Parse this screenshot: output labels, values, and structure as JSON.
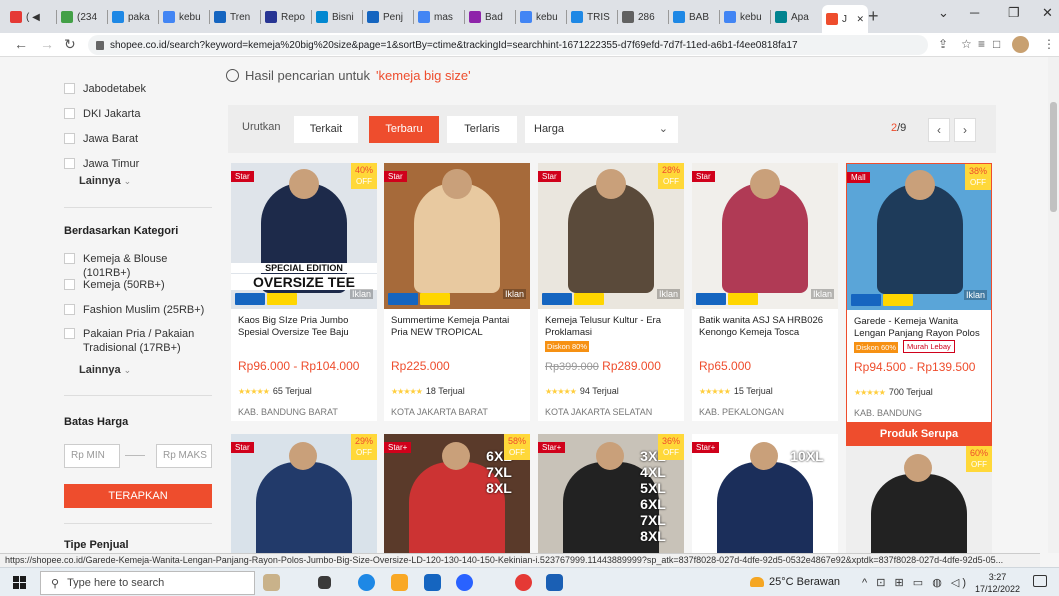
{
  "browser": {
    "tabs": [
      {
        "label": "( ◀",
        "color": "#e53935"
      },
      {
        "label": "(234",
        "color": "#43a047"
      },
      {
        "label": "paka",
        "color": "#1e88e5"
      },
      {
        "label": "kebu",
        "color": "#4285f4"
      },
      {
        "label": "Tren",
        "color": "#1565c0"
      },
      {
        "label": "Repo",
        "color": "#283593"
      },
      {
        "label": "Bisni",
        "color": "#0288d1"
      },
      {
        "label": "Penj",
        "color": "#1565c0"
      },
      {
        "label": "mas",
        "color": "#4285f4"
      },
      {
        "label": "Bad",
        "color": "#8e24aa"
      },
      {
        "label": "kebu",
        "color": "#4285f4"
      },
      {
        "label": "TRIS",
        "color": "#1e88e5"
      },
      {
        "label": "286",
        "color": "#616161"
      },
      {
        "label": "BAB",
        "color": "#1e88e5"
      },
      {
        "label": "kebu",
        "color": "#4285f4"
      },
      {
        "label": "Apa",
        "color": "#00838f"
      },
      {
        "label": "J",
        "color": "#ee4d2d"
      }
    ],
    "new_tab": "+",
    "url": "shopee.co.id/search?keyword=kemeja%20big%20size&page=1&sortBy=ctime&trackingId=searchhint-1671222355-d7f69efd-7d7f-11ed-a6b1-f4ee0818fa17"
  },
  "sidebar": {
    "locations": [
      "Jabodetabek",
      "DKI Jakarta",
      "Jawa Barat",
      "Jawa Timur"
    ],
    "more1": "Lainnya",
    "category_title": "Berdasarkan Kategori",
    "categories": [
      "Kemeja & Blouse (101RB+)",
      "Kemeja (50RB+)",
      "Fashion Muslim (25RB+)",
      "Pakaian Pria / Pakaian Tradisional (17RB+)"
    ],
    "more2": "Lainnya",
    "price_title": "Batas Harga",
    "min_placeholder": "Rp MIN",
    "max_placeholder": "Rp MAKS",
    "apply": "TERAPKAN",
    "type_title": "Tipe Penjual"
  },
  "results": {
    "prefix": "Hasil pencarian untuk",
    "keyword": "'kemeja big size'"
  },
  "sort": {
    "label": "Urutkan",
    "options": [
      "Terkait",
      "Terbaru",
      "Terlaris"
    ],
    "price": "Harga",
    "page_current": "2",
    "page_total": "/9"
  },
  "products": [
    {
      "name": "Kaos Big SIze Pria Jumbo Spesial Oversize Tee Baju Bes...",
      "price": "Rp96.000 - Rp104.000",
      "old_price": "",
      "sold": "65 Terjual",
      "location": "KAB. BANDUNG BARAT",
      "badge": "Star",
      "discount": "40%",
      "tag": "",
      "tag2": "",
      "img_overlay": "SPECIAL EDITION",
      "img_overlay2": "OVERSIZE TEE",
      "bg": "#dfe4ea",
      "fg": "#1d2a4a"
    },
    {
      "name": "Summertime Kemeja Pantai Pria NEW TROPICAL SUMMER...",
      "price": "Rp225.000",
      "old_price": "",
      "sold": "18 Terjual",
      "location": "KOTA JAKARTA BARAT",
      "badge": "Star",
      "discount": "",
      "tag": "",
      "tag2": "",
      "img_overlay": "",
      "img_overlay2": "",
      "bg": "#a66a3a",
      "fg": "#e8c9a0"
    },
    {
      "name": "Kemeja Telusur Kultur - Era Proklamasi",
      "price": "Rp289.000",
      "old_price": "Rp399.000",
      "sold": "94 Terjual",
      "location": "KOTA JAKARTA SELATAN",
      "badge": "Star",
      "discount": "28%",
      "tag": "Diskon 80%",
      "tag2": "",
      "img_overlay": "",
      "img_overlay2": "",
      "bg": "#eae6de",
      "fg": "#5a4a3a"
    },
    {
      "name": "Batik wanita ASJ SA HRB026 Kenongo Kemeja Tosca Pendek",
      "price": "Rp65.000",
      "old_price": "",
      "sold": "15 Terjual",
      "location": "KAB. PEKALONGAN",
      "badge": "Star",
      "discount": "",
      "tag": "",
      "tag2": "",
      "img_overlay": "",
      "img_overlay2": "",
      "bg": "#f1efeb",
      "fg": "#b03a55"
    },
    {
      "name": "Garede - Kemeja Wanita Lengan Panjang Rayon Polos Jumbo...",
      "price": "Rp94.500 - Rp139.500",
      "old_price": "",
      "sold": "700 Terjual",
      "location": "KAB. BANDUNG",
      "badge": "Mall",
      "discount": "38%",
      "tag": "Diskon 60%",
      "tag2": "Murah Lebay",
      "img_overlay": "",
      "img_overlay2": "",
      "bg": "#5aa5d8",
      "fg": "#1e3b5a"
    }
  ],
  "products_row2": [
    {
      "badge": "Star",
      "discount": "29%",
      "bg": "#d9e2ea",
      "fg": "#223a6a",
      "overlay": ""
    },
    {
      "badge": "Star+",
      "discount": "58%",
      "bg": "#5a3a2a",
      "fg": "#c33",
      "overlay": "6XL 7XL 8XL"
    },
    {
      "badge": "Star+",
      "discount": "36%",
      "bg": "#c8c2b8",
      "fg": "#222",
      "overlay": "3XL 4XL 5XL 6XL 7XL 8XL"
    },
    {
      "badge": "Star+",
      "discount": "",
      "bg": "#fff",
      "fg": "#1b2e5a",
      "overlay": "10XL"
    },
    {
      "badge": "",
      "discount": "60%",
      "bg": "#eee",
      "fg": "#222",
      "overlay": ""
    }
  ],
  "lowerbar": {
    "similar": "Produk Serupa"
  },
  "status_url": "https://shopee.co.id/Garede-Kemeja-Wanita-Lengan-Panjang-Rayon-Polos-Jumbo-Big-Size-Oversize-LD-120-130-140-150-Kekinian-i.523767999.11443889999?sp_atk=837f8028-027d-4dfe-92d5-0532e4867e92&xptdk=837f8028-027d-4dfe-92d5-05...",
  "taskbar": {
    "search_placeholder": "Type here to search",
    "weather": "25°C Berawan",
    "time": "3:27",
    "date": "17/12/2022"
  },
  "colors": {
    "accent": "#ee4d2d"
  }
}
